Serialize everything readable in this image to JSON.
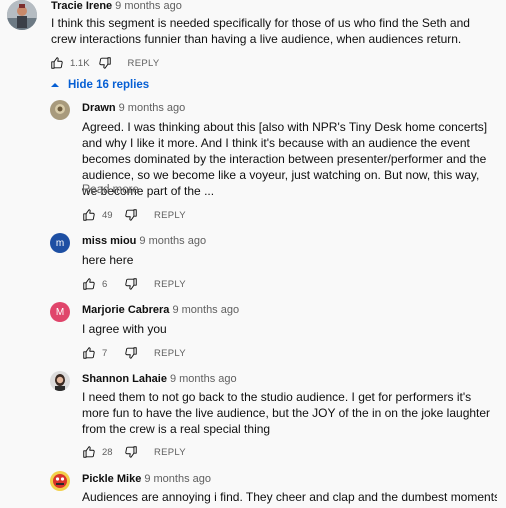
{
  "top_comment": {
    "author": "Tracie Irene",
    "time": "9 months ago",
    "text": "I think this segment is needed specifically for those of us who find the Seth and crew interactions funnier than having a live audience, when audiences return.",
    "likes": "1.1K",
    "reply_label": "REPLY"
  },
  "replies_toggle": {
    "label": "Hide 16 replies",
    "color": "#065fd4"
  },
  "replies": [
    {
      "author": "Drawn",
      "time": "9 months ago",
      "text": "Agreed. I was thinking about this [also with NPR's Tiny Desk home concerts] and why I like it more. And I think it's because with an audience the event becomes dominated by the interaction between presenter/performer and the audience, so we become like a voyeur, just watching on. But now, this way, we become part of the ...",
      "read_more": "Read more",
      "likes": "49",
      "reply_label": "REPLY"
    },
    {
      "author": "miss miou",
      "time": "9 months ago",
      "avatar_letter": "m",
      "avatar_color": "#1e4fa3",
      "text": "here here",
      "likes": "6",
      "reply_label": "REPLY"
    },
    {
      "author": "Marjorie Cabrera",
      "time": "9 months ago",
      "avatar_letter": "M",
      "avatar_color": "#e0456b",
      "text": "I agree with you",
      "likes": "7",
      "reply_label": "REPLY"
    },
    {
      "author": "Shannon Lahaie",
      "time": "9 months ago",
      "text": "I need them to not go back to the studio audience. I get for performers it's more fun to have the live audience, but the JOY of the in on the joke laughter from the crew is a real special thing",
      "likes": "28",
      "reply_label": "REPLY"
    },
    {
      "author": "Pickle Mike",
      "time": "9 months ago",
      "text": "Audiences are annoying i find.  They cheer and clap and the dumbest moments,"
    }
  ]
}
